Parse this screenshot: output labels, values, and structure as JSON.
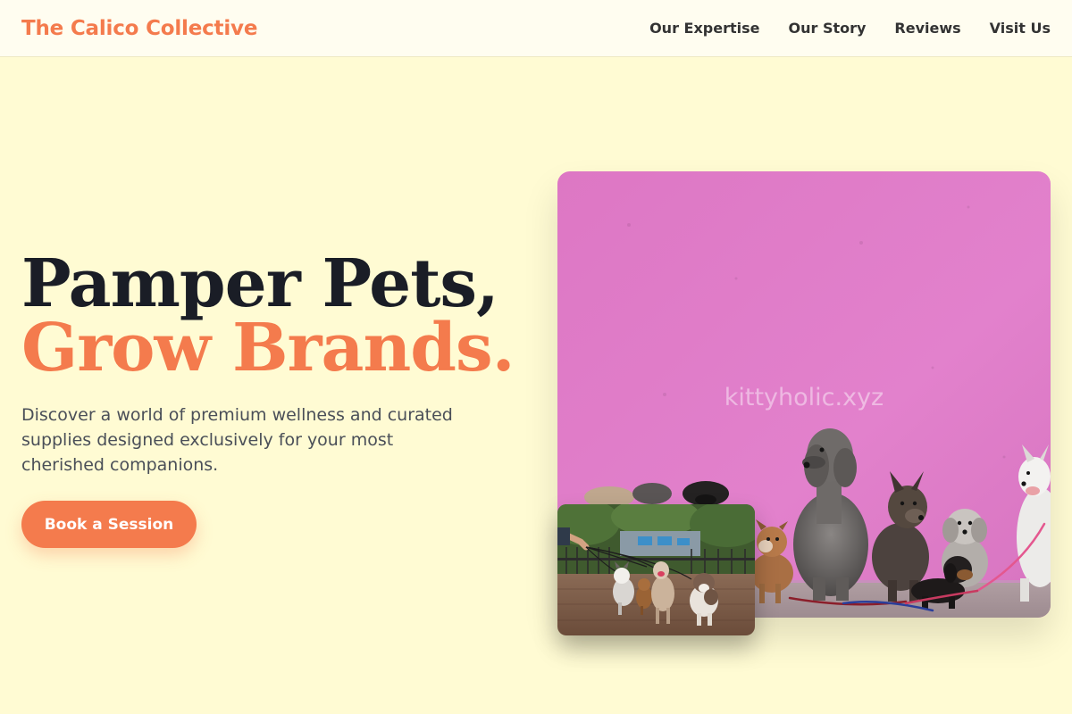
{
  "header": {
    "brand": "The Calico Collective",
    "nav": [
      "Our Expertise",
      "Our Story",
      "Reviews",
      "Visit Us"
    ]
  },
  "hero": {
    "title_line1": "Pamper Pets,",
    "title_line2": "Grow Brands.",
    "description": "Discover a world of premium wellness and curated supplies designed exclusively for your most cherished companions.",
    "cta_label": "Book a Session"
  },
  "images": {
    "main": {
      "subject": "dogs-against-pink-wall-photo",
      "watermark": "kittyholic.xyz"
    },
    "secondary": {
      "subject": "dog-walker-with-dogs-in-park-photo"
    }
  },
  "colors": {
    "accent": "#f47b4d",
    "background": "#fffbd3",
    "heading": "#1a1d26",
    "wall": "#e07cc8"
  }
}
